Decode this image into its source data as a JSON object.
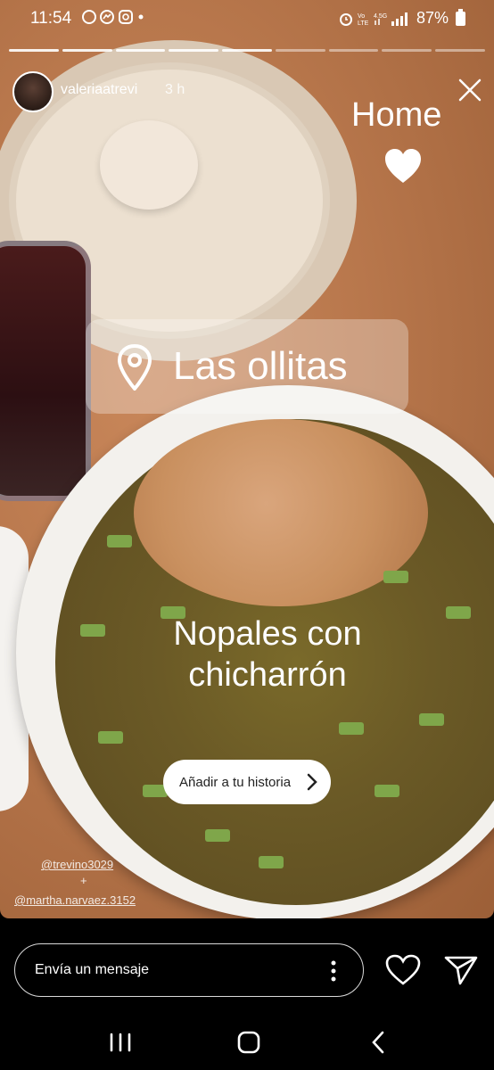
{
  "status_bar": {
    "time": "11:54",
    "left_icons": [
      "whatsapp-icon",
      "messenger-icon",
      "instagram-icon",
      "dot"
    ],
    "right_icons": [
      "alarm-icon",
      "volte-icon",
      "4g-icon",
      "signal-icon"
    ],
    "battery": "87%"
  },
  "story": {
    "progress_segments": 9,
    "progress_completed": 5,
    "user": {
      "username": "valeriaatrevi",
      "time_ago": "3 h"
    },
    "stickers": {
      "home_text": "Home",
      "location": "Las ollitas",
      "caption_line1": "Nopales con",
      "caption_line2": "chicharrón",
      "mentions": [
        "@trevino3029",
        "+",
        "@martha.narvaez.3152"
      ]
    },
    "add_to_story_label": "Añadir a tu historia"
  },
  "reply_bar": {
    "placeholder": "Envía un mensaje"
  },
  "colors": {
    "background": "#000000",
    "table": "#b8774c",
    "plate": "#f3f1ed"
  }
}
